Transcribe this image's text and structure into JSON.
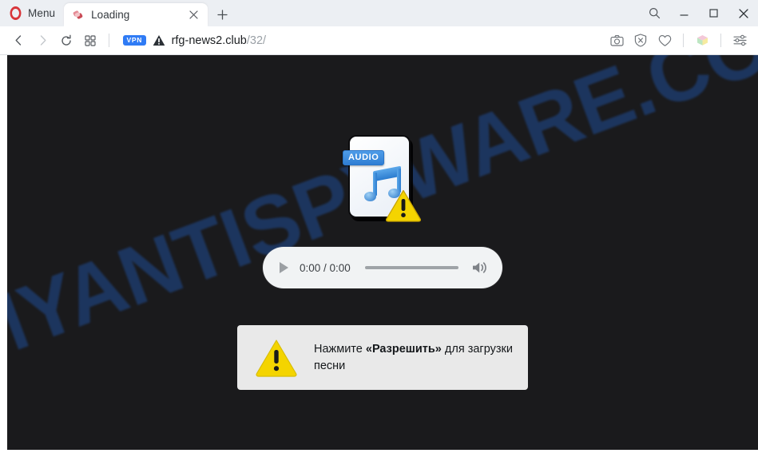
{
  "browser": {
    "name": "Opera",
    "menu_label": "Menu",
    "tab": {
      "title": "Loading",
      "favicon": "site-favicon",
      "close_icon": "close-icon"
    },
    "new_tab_icon": "plus-icon",
    "window_controls": [
      {
        "name": "search-icon",
        "label": "Search"
      },
      {
        "name": "minimize-icon",
        "label": "Minimize"
      },
      {
        "name": "maximize-icon",
        "label": "Maximize"
      },
      {
        "name": "close-window-icon",
        "label": "Close"
      }
    ],
    "toolbar": {
      "back_icon": "back-arrow-icon",
      "forward_icon": "forward-arrow-icon",
      "reload_icon": "reload-icon",
      "workspaces_icon": "grid-icon",
      "vpn_label": "VPN",
      "site_security_icon": "insecure-warning-icon",
      "url_domain": "rfg-news2.club",
      "url_path": "/32/",
      "right_icons": [
        {
          "name": "snapshot-camera-icon",
          "label": "Snapshot"
        },
        {
          "name": "ad-blocker-shield-icon",
          "label": "Ad blocker"
        },
        {
          "name": "heart-icon",
          "label": "Add to favorites"
        },
        {
          "name": "extensions-cube-icon",
          "label": "Extensions"
        },
        {
          "name": "easy-setup-sliders-icon",
          "label": "Easy setup"
        }
      ]
    }
  },
  "page": {
    "background_color": "#1a1a1c",
    "watermark_text": "MYANTISPYWARE.COM",
    "watermark_color": "#1d3762",
    "file_icon": {
      "badge_label": "AUDIO",
      "badge_color": "#2f7ed4",
      "note_color": "#2b7ccf",
      "warning_color": "#f4d400"
    },
    "audio_player": {
      "play_icon": "play-triangle-icon",
      "time_display": "0:00 / 0:00",
      "volume_icon": "volume-icon",
      "progress_percent": 0
    },
    "notice": {
      "warning_icon": "warning-triangle-icon",
      "warning_color": "#f4d400",
      "text_before": "Нажмите ",
      "text_bold": "«Разрешить»",
      "text_after": " для загрузки песни"
    }
  }
}
